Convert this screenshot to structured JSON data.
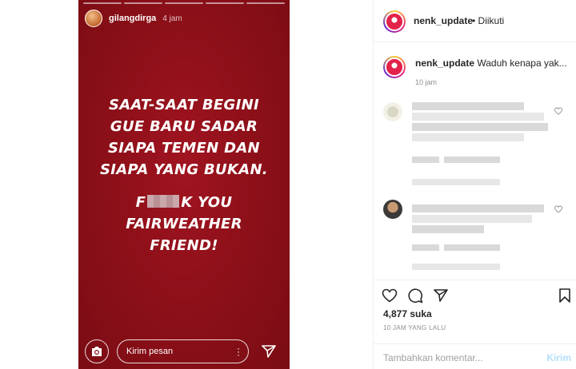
{
  "story": {
    "username": "gilangdirga",
    "time": "4 jam",
    "line1": "SAAT-SAAT BEGINI",
    "line2": "GUE BARU SADAR",
    "line3": "SIAPA TEMEN DAN",
    "line4": "SIAPA YANG BUKAN.",
    "line5_start": "F",
    "line5_end": "K YOU",
    "line6": "FAIRWEATHER",
    "line7": "FRIEND!",
    "reply_placeholder": "Kirim pesan"
  },
  "post": {
    "username": "nenk_update",
    "follow_status": "• Diikuti",
    "caption_user": "nenk_update",
    "caption_text": "Waduh kenapa yak...",
    "caption_time": "10 jam",
    "likes": "4,877 suka",
    "time_ago": "10 JAM YANG LALU",
    "comment_placeholder": "Tambahkan komentar...",
    "post_button": "Kirim"
  },
  "icons": {
    "camera": "camera-icon",
    "menu": "more-vertical-icon",
    "send": "send-icon",
    "like": "heart-icon",
    "comment": "comment-icon",
    "share": "share-icon",
    "save": "bookmark-icon"
  },
  "colors": {
    "story_bg": "#8e1019",
    "accent_link": "#b2dffc",
    "text": "#262626",
    "muted": "#8e8e8e"
  }
}
